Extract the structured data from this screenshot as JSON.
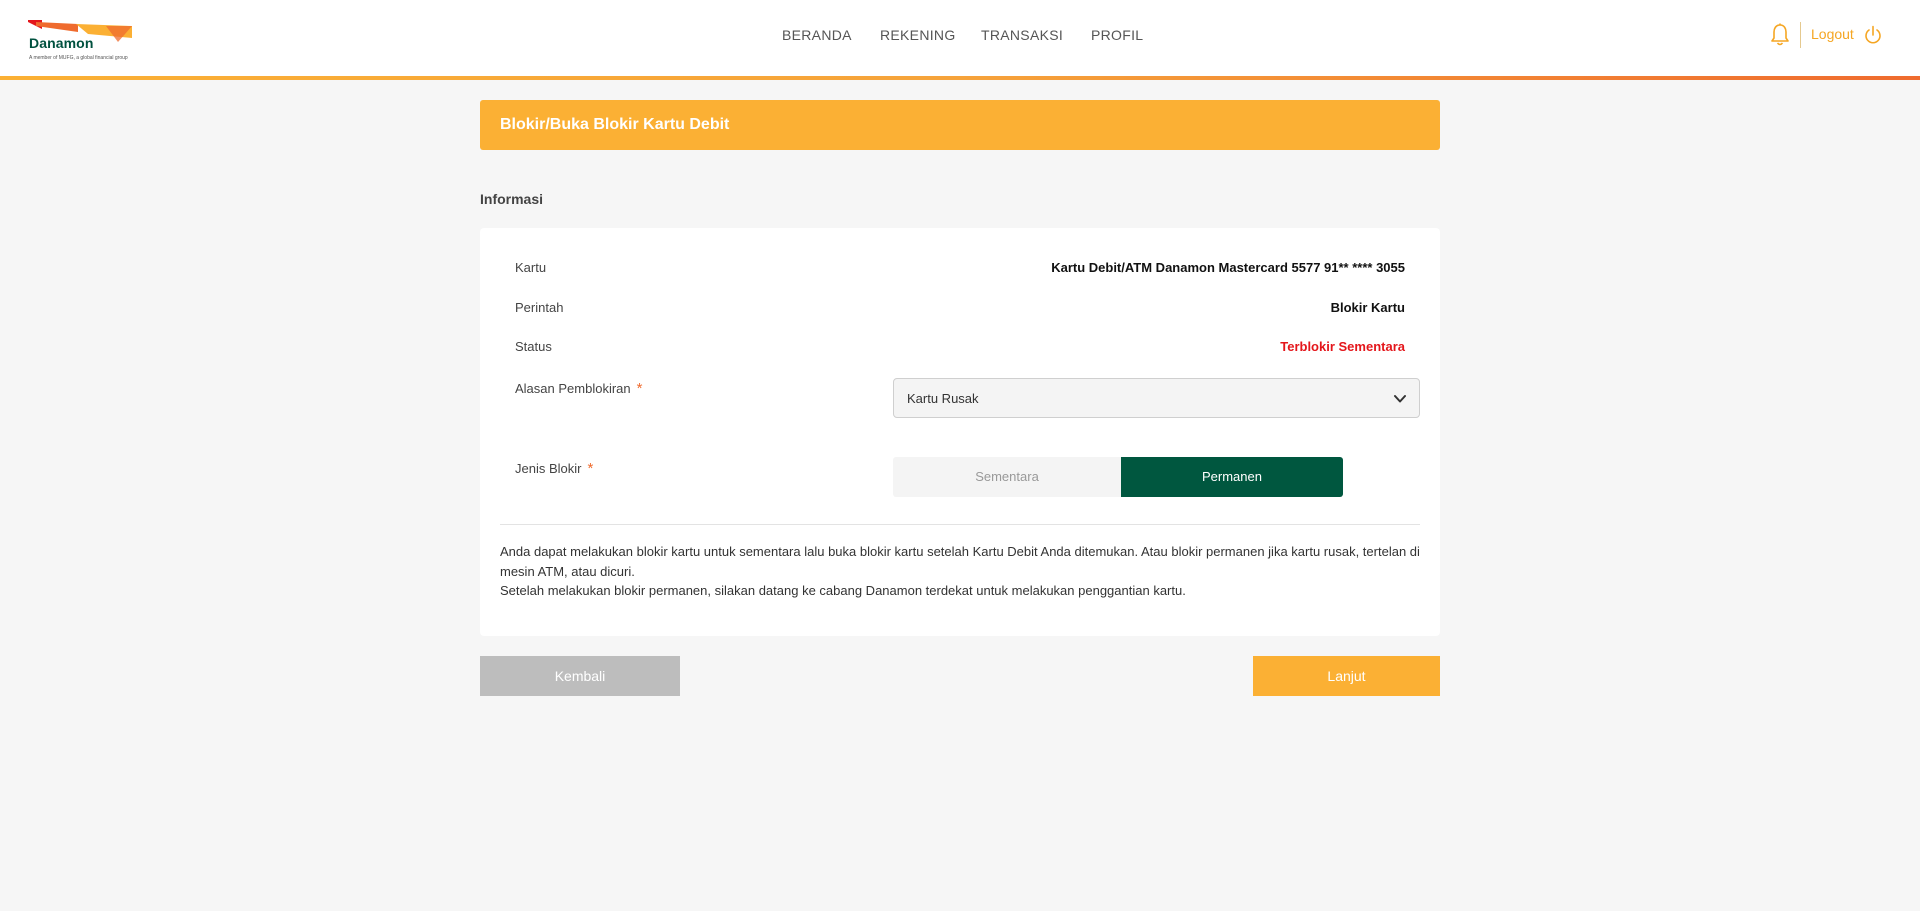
{
  "header": {
    "logo_name": "Danamon",
    "logo_tagline": "A member of MUFG, a global financial group",
    "nav": [
      "BERANDA",
      "REKENING",
      "TRANSAKSI",
      "PROFIL"
    ],
    "logout_label": "Logout",
    "icons": {
      "notification": "bell-icon",
      "logout": "power-icon"
    }
  },
  "page": {
    "title": "Blokir/Buka Blokir Kartu Debit",
    "section_label": "Informasi"
  },
  "details": {
    "card_label": "Kartu",
    "card_value": "Kartu Debit/ATM Danamon Mastercard 5577 91** **** 3055",
    "command_label": "Perintah",
    "command_value": "Blokir Kartu",
    "status_label": "Status",
    "status_value": "Terblokir Sementara"
  },
  "form": {
    "reason_label": "Alasan Pemblokiran",
    "reason_value": "Kartu Rusak",
    "type_label": "Jenis Blokir",
    "type_options": [
      "Sementara",
      "Permanen"
    ],
    "type_selected": "Permanen",
    "required_mark": "*"
  },
  "info": {
    "line1": "Anda dapat melakukan blokir kartu untuk sementara lalu buka blokir kartu setelah Kartu Debit Anda ditemukan. Atau blokir permanen jika kartu rusak, tertelan di mesin ATM, atau dicuri.",
    "line2": "Setelah melakukan blokir permanen, silakan datang ke cabang Danamon terdekat untuk melakukan penggantian kartu."
  },
  "buttons": {
    "back": "Kembali",
    "next": "Lanjut"
  },
  "colors": {
    "accent": "#fbb034",
    "brand_green": "#00573f",
    "status_red": "#e4161b",
    "header_gradient_end": "#ef6b2e"
  }
}
